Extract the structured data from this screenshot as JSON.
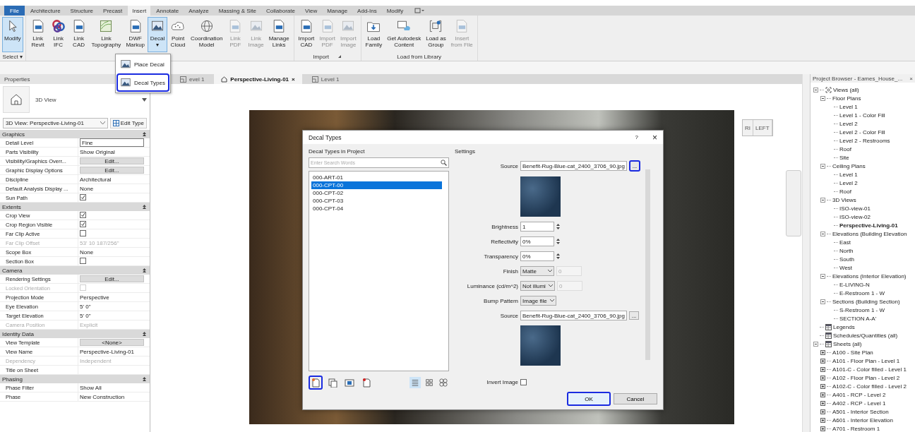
{
  "ribbon_tabs": [
    {
      "label": "File",
      "kind": "file",
      "selected": false
    },
    {
      "label": "Architecture",
      "kind": "tab",
      "selected": false
    },
    {
      "label": "Structure",
      "kind": "tab",
      "selected": false
    },
    {
      "label": "Precast",
      "kind": "tab",
      "selected": false
    },
    {
      "label": "Insert",
      "kind": "tab",
      "selected": true
    },
    {
      "label": "Annotate",
      "kind": "tab",
      "selected": false
    },
    {
      "label": "Analyze",
      "kind": "tab",
      "selected": false
    },
    {
      "label": "Massing & Site",
      "kind": "tab",
      "selected": false
    },
    {
      "label": "Collaborate",
      "kind": "tab",
      "selected": false
    },
    {
      "label": "View",
      "kind": "tab",
      "selected": false
    },
    {
      "label": "Manage",
      "kind": "tab",
      "selected": false
    },
    {
      "label": "Add-Ins",
      "kind": "tab",
      "selected": false
    },
    {
      "label": "Modify",
      "kind": "tab",
      "selected": false
    }
  ],
  "ribbon_panels": [
    {
      "label": "Select ▾",
      "buttons": [
        {
          "lines": [
            "Modify"
          ],
          "kind": "pointer",
          "selected": true,
          "disabled": false
        }
      ]
    },
    {
      "buttons": [
        {
          "lines": [
            "Link",
            "Revit"
          ],
          "kind": "doc",
          "selected": false,
          "disabled": false
        },
        {
          "lines": [
            "Link",
            "IFC"
          ],
          "kind": "rings",
          "selected": false,
          "disabled": false
        },
        {
          "lines": [
            "Link",
            "CAD"
          ],
          "kind": "doc",
          "selected": false,
          "disabled": false
        },
        {
          "lines": [
            "Link",
            "Topography"
          ],
          "kind": "topo",
          "selected": false,
          "disabled": false
        },
        {
          "lines": [
            "DWF",
            "Markup"
          ],
          "kind": "doc",
          "selected": false,
          "disabled": false
        },
        {
          "lines": [
            "Decal",
            "▾"
          ],
          "kind": "picture",
          "selected": true,
          "disabled": false
        },
        {
          "lines": [
            "Point",
            "Cloud"
          ],
          "kind": "cloud",
          "selected": false,
          "disabled": false
        },
        {
          "lines": [
            "Coordination",
            "Model"
          ],
          "kind": "sphere",
          "selected": false,
          "disabled": false
        },
        {
          "lines": [
            "Link",
            "PDF"
          ],
          "kind": "doc",
          "selected": false,
          "disabled": true
        },
        {
          "lines": [
            "Link",
            "Image"
          ],
          "kind": "picture",
          "selected": false,
          "disabled": true
        },
        {
          "lines": [
            "Manage",
            "Links"
          ],
          "kind": "doc",
          "selected": false,
          "disabled": false
        }
      ]
    },
    {
      "label": "Import",
      "launcher": true,
      "buttons": [
        {
          "lines": [
            "Import",
            "CAD"
          ],
          "kind": "doc",
          "selected": false,
          "disabled": false
        },
        {
          "lines": [
            "Import",
            "PDF"
          ],
          "kind": "doc",
          "selected": false,
          "disabled": true
        },
        {
          "lines": [
            "Import",
            "Image"
          ],
          "kind": "picture",
          "selected": false,
          "disabled": true
        }
      ]
    },
    {
      "label": "Load from Library",
      "buttons": [
        {
          "lines": [
            "Load",
            "Family"
          ],
          "kind": "folder",
          "selected": false,
          "disabled": false
        },
        {
          "lines": [
            "Get Autodesk",
            "Content"
          ],
          "kind": "monitor",
          "selected": false,
          "disabled": false
        },
        {
          "lines": [
            "Load as",
            "Group"
          ],
          "kind": "group",
          "selected": false,
          "disabled": false
        },
        {
          "lines": [
            "Insert",
            "from File"
          ],
          "kind": "doc",
          "selected": false,
          "disabled": true
        }
      ]
    }
  ],
  "decal_menu": [
    {
      "label": "Place Decal",
      "highlighted": false
    },
    {
      "label": "Decal Types",
      "highlighted": true
    }
  ],
  "properties": {
    "title": "Properties",
    "type_name": "3D View",
    "instance": "3D View: Perspective-Living-01",
    "edit_type": "Edit Type",
    "groups": [
      {
        "name": "Graphics",
        "rows": [
          {
            "label": "Detail Level",
            "kind": "input",
            "value": "Fine",
            "disabled": false
          },
          {
            "label": "Parts Visibility",
            "kind": "text",
            "value": "Show Original",
            "disabled": false
          },
          {
            "label": "Visibility/Graphics Overr...",
            "kind": "button",
            "value": "Edit...",
            "disabled": false
          },
          {
            "label": "Graphic Display Options",
            "kind": "button",
            "value": "Edit...",
            "disabled": false
          },
          {
            "label": "Discipline",
            "kind": "text",
            "value": "Architectural",
            "disabled": false
          },
          {
            "label": "Default Analysis Display ...",
            "kind": "text",
            "value": "None",
            "disabled": false
          },
          {
            "label": "Sun Path",
            "kind": "check",
            "checked": true,
            "disabled": false
          }
        ]
      },
      {
        "name": "Extents",
        "rows": [
          {
            "label": "Crop View",
            "kind": "check",
            "checked": true,
            "disabled": false
          },
          {
            "label": "Crop Region Visible",
            "kind": "check",
            "checked": true,
            "disabled": false
          },
          {
            "label": "Far Clip Active",
            "kind": "check",
            "checked": false,
            "disabled": false
          },
          {
            "label": "Far Clip Offset",
            "kind": "text",
            "value": "53'  10 187/256\"",
            "disabled": true
          },
          {
            "label": "Scope Box",
            "kind": "text",
            "value": "None",
            "disabled": false
          },
          {
            "label": "Section Box",
            "kind": "check",
            "checked": false,
            "disabled": false
          }
        ]
      },
      {
        "name": "Camera",
        "rows": [
          {
            "label": "Rendering Settings",
            "kind": "button",
            "value": "Edit...",
            "disabled": false
          },
          {
            "label": "Locked Orientation",
            "kind": "check",
            "checked": false,
            "disabled": true
          },
          {
            "label": "Projection Mode",
            "kind": "text",
            "value": "Perspective",
            "disabled": false
          },
          {
            "label": "Eye Elevation",
            "kind": "text",
            "value": "5'  0\"",
            "disabled": false
          },
          {
            "label": "Target Elevation",
            "kind": "text",
            "value": "5'  0\"",
            "disabled": false
          },
          {
            "label": "Camera Position",
            "kind": "text",
            "value": "Explicit",
            "disabled": true
          }
        ]
      },
      {
        "name": "Identity Data",
        "rows": [
          {
            "label": "View Template",
            "kind": "button",
            "value": "<None>",
            "disabled": false
          },
          {
            "label": "View Name",
            "kind": "text",
            "value": "Perspective-Living-01",
            "disabled": false
          },
          {
            "label": "Dependency",
            "kind": "text",
            "value": "Independent",
            "disabled": true
          },
          {
            "label": "Title on Sheet",
            "kind": "text",
            "disabled": false
          }
        ]
      },
      {
        "name": "Phasing",
        "rows": [
          {
            "label": "Phase Filter",
            "kind": "text",
            "value": "Show All",
            "disabled": false
          },
          {
            "label": "Phase",
            "kind": "text",
            "value": "New Construction",
            "disabled": false
          }
        ]
      }
    ]
  },
  "view_tabs": [
    {
      "label": "evel 1",
      "kind": "plan",
      "selected": false
    },
    {
      "label": "Perspective-Living-01",
      "kind": "perspective",
      "selected": true,
      "close": "×"
    },
    {
      "label": "Level 1",
      "kind": "plan",
      "selected": false
    }
  ],
  "view_cube": {
    "faces": [
      "RI",
      "LEFT"
    ]
  },
  "dialog": {
    "title": "Decal Types",
    "help": "?",
    "close": "×",
    "list_label": "Decal Types in Project",
    "search_placeholder": "Enter Search Words",
    "types": [
      {
        "label": "000-ART-01",
        "selected": false
      },
      {
        "label": "000-CPT-00",
        "selected": true
      },
      {
        "label": "000-CPT-02",
        "selected": false
      },
      {
        "label": "000-CPT-03",
        "selected": false
      },
      {
        "label": "000-CPT-04",
        "selected": false
      }
    ],
    "type_tools": [
      {
        "kind": "new",
        "highlighted": true
      },
      {
        "kind": "duplicate",
        "highlighted": false
      },
      {
        "kind": "rename",
        "highlighted": false
      },
      {
        "kind": "delete",
        "highlighted": false
      }
    ],
    "view_modes": [
      {
        "kind": "list",
        "selected": true
      },
      {
        "kind": "small",
        "selected": false
      },
      {
        "kind": "large",
        "selected": false
      }
    ],
    "settings_label": "Settings",
    "settings": [
      {
        "kind": "file",
        "label": "Source",
        "value": "Benefit-Rug-Blue-cat_2400_3706_90.jpg",
        "browse": "...",
        "highlighted": true
      },
      {
        "kind": "image"
      },
      {
        "kind": "spinner",
        "label": "Brightness",
        "value": "1"
      },
      {
        "kind": "spinner",
        "label": "Reflectivity",
        "value": "0%"
      },
      {
        "kind": "spinner",
        "label": "Transparency",
        "value": "0%"
      },
      {
        "kind": "select",
        "label": "Finish",
        "value": "Matte",
        "extra": "0"
      },
      {
        "kind": "select",
        "label": "Luminance (cd/m^2)",
        "value": "Not illumi",
        "extra": "0"
      },
      {
        "kind": "select",
        "label": "Bump Pattern",
        "value": "Image file"
      },
      {
        "kind": "file",
        "label": "Source",
        "value": "Benefit-Rug-Blue-cat_2400_3706_90.jpg",
        "browse": "...",
        "highlighted": false
      },
      {
        "kind": "image"
      },
      {
        "kind": "check",
        "label": "Invert Image",
        "checked": false
      }
    ],
    "buttons": [
      {
        "label": "OK",
        "highlighted": true
      },
      {
        "label": "Cancel",
        "highlighted": false
      }
    ]
  },
  "project_browser": {
    "title": "Project Browser - Eames_House_...",
    "close": "×",
    "tree": [
      {
        "label": "Views (all)",
        "kind": "views",
        "expanded": true,
        "children": [
          {
            "label": "Floor Plans",
            "expanded": true,
            "children": [
              {
                "label": "Level 1"
              },
              {
                "label": "Level 1 - Color Fill"
              },
              {
                "label": "Level 2"
              },
              {
                "label": "Level 2 - Color Fill"
              },
              {
                "label": "Level 2 - Restrooms"
              },
              {
                "label": "Roof"
              },
              {
                "label": "Site"
              }
            ]
          },
          {
            "label": "Ceiling Plans",
            "expanded": true,
            "children": [
              {
                "label": "Level 1"
              },
              {
                "label": "Level 2"
              },
              {
                "label": "Roof"
              }
            ]
          },
          {
            "label": "3D Views",
            "expanded": true,
            "children": [
              {
                "label": "ISO-view-01",
                "selected": false
              },
              {
                "label": "ISO-view-02",
                "selected": false
              },
              {
                "label": "Perspective-Living-01",
                "selected": true
              }
            ]
          },
          {
            "label": "Elevations (Building Elevation",
            "expanded": true,
            "children": [
              {
                "label": "East"
              },
              {
                "label": "North"
              },
              {
                "label": "South"
              },
              {
                "label": "West"
              }
            ]
          },
          {
            "label": "Elevations (Interior Elevation)",
            "expanded": true,
            "children": [
              {
                "label": "E-LIVING-N"
              },
              {
                "label": "E-Restroom 1 - W"
              }
            ]
          },
          {
            "label": "Sections (Building Section)",
            "expanded": true,
            "children": [
              {
                "label": "S-Restroom 1 - W"
              },
              {
                "label": "SECTION A-A'"
              }
            ]
          }
        ]
      },
      {
        "label": "Legends",
        "kind": "legends"
      },
      {
        "label": "Schedules/Quantities (all)",
        "kind": "schedules"
      },
      {
        "label": "Sheets (all)",
        "kind": "sheets",
        "expanded": true,
        "children": [
          {
            "label": "A100 - Site Plan",
            "expanded": false
          },
          {
            "label": "A101 - Floor Plan - Level 1",
            "expanded": false
          },
          {
            "label": "A101-C - Color filled - Level 1",
            "expanded": false
          },
          {
            "label": "A102 - Floor Plan - Level 2",
            "expanded": false
          },
          {
            "label": "A102-C - Color filled - Level 2",
            "expanded": false
          },
          {
            "label": "A401 - RCP - Level 2",
            "expanded": false
          },
          {
            "label": "A402 - RCP - Level 1",
            "expanded": false
          },
          {
            "label": "A501 - Interior Section",
            "expanded": false
          },
          {
            "label": "A601 - Interior Elevation",
            "expanded": false
          },
          {
            "label": "A701 - Restroom 1",
            "expanded": false
          }
        ]
      }
    ]
  }
}
